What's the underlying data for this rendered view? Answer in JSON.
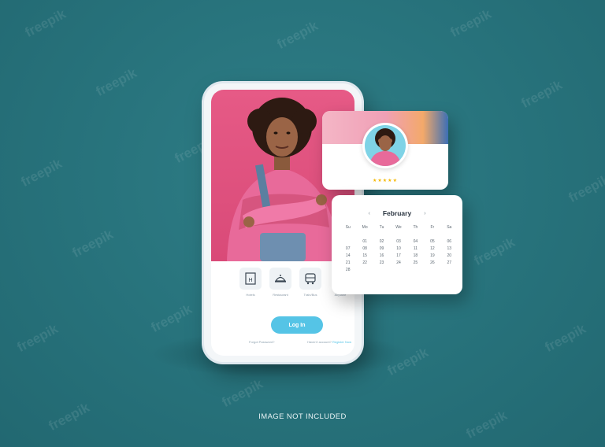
{
  "watermark": "freepik",
  "phone": {
    "services": [
      {
        "icon": "hotel-icon",
        "label": "Hotels"
      },
      {
        "icon": "restaurant-icon",
        "label": "Restaurant"
      },
      {
        "icon": "bus-icon",
        "label": "Train/Bus"
      },
      {
        "icon": "plane-icon",
        "label": "Airplane"
      }
    ],
    "login_label": "Log In",
    "forgot_label": "Forgot Password?",
    "no_account_label": "Haven't account?",
    "signup_label": "Register Now"
  },
  "profile_card": {
    "rating": "★★★★★"
  },
  "calendar": {
    "month": "February",
    "prev_icon": "‹",
    "next_icon": "›",
    "weekdays": [
      "Su",
      "Mo",
      "Tu",
      "We",
      "Th",
      "Fr",
      "Sa"
    ],
    "days": [
      "",
      "01",
      "02",
      "03",
      "04",
      "05",
      "06",
      "07",
      "08",
      "09",
      "10",
      "11",
      "12",
      "13",
      "14",
      "15",
      "16",
      "17",
      "18",
      "19",
      "20",
      "21",
      "22",
      "23",
      "24",
      "25",
      "26",
      "27",
      "28",
      "",
      "",
      "",
      "",
      "",
      ""
    ]
  },
  "caption": "IMAGE NOT INCLUDED",
  "colors": {
    "background": "#27727b",
    "accent": "#55c4e6",
    "hero": "#e65a86",
    "star": "#f5b800"
  }
}
